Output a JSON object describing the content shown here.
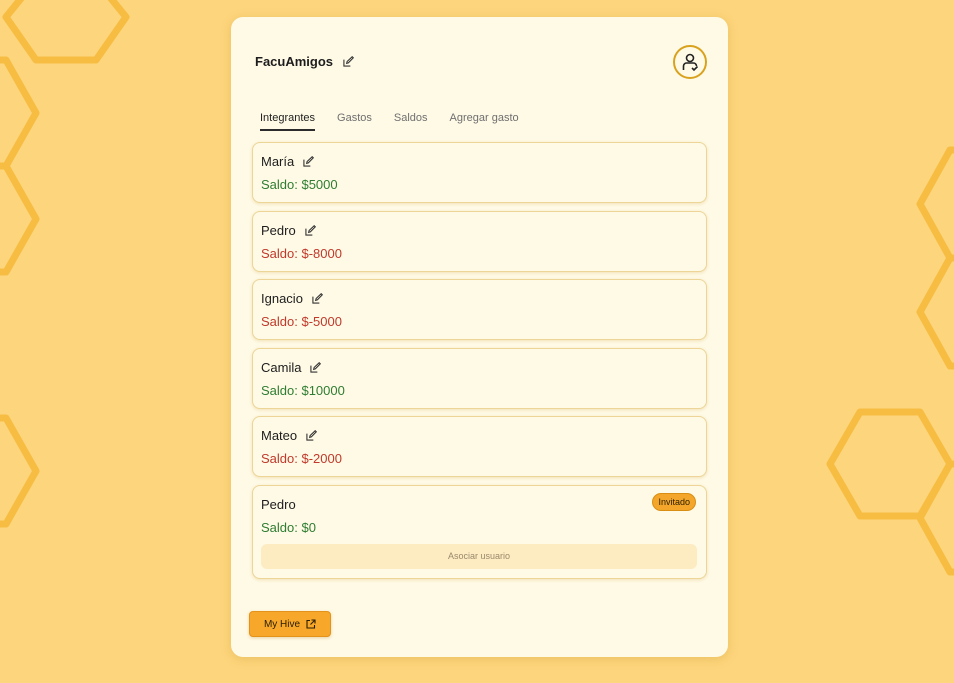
{
  "group": {
    "name": "FacuAmigos"
  },
  "tabs": [
    "Integrantes",
    "Gastos",
    "Saldos",
    "Agregar gasto"
  ],
  "members": [
    {
      "name": "María",
      "balance": "Saldo: $5000",
      "status": "positive"
    },
    {
      "name": "Pedro",
      "balance": "Saldo: $-8000",
      "status": "negative"
    },
    {
      "name": "Ignacio",
      "balance": "Saldo: $-5000",
      "status": "negative"
    },
    {
      "name": "Camila",
      "balance": "Saldo: $10000",
      "status": "positive"
    },
    {
      "name": "Mateo",
      "balance": "Saldo: $-2000",
      "status": "negative"
    },
    {
      "name": "Pedro",
      "balance": "Saldo: $0",
      "status": "positive",
      "badge": "Invitado",
      "associate_label": "Asociar usuario"
    }
  ],
  "footer": {
    "hive_label": "My Hive"
  },
  "icons": {
    "edit": "edit-icon",
    "avatar": "user-check-icon",
    "external": "external-link-icon"
  },
  "colors": {
    "background": "#fdd57c",
    "card": "#fffae6",
    "accent": "#f7a72a",
    "positive": "#2e7d32",
    "negative": "#c0392b"
  }
}
